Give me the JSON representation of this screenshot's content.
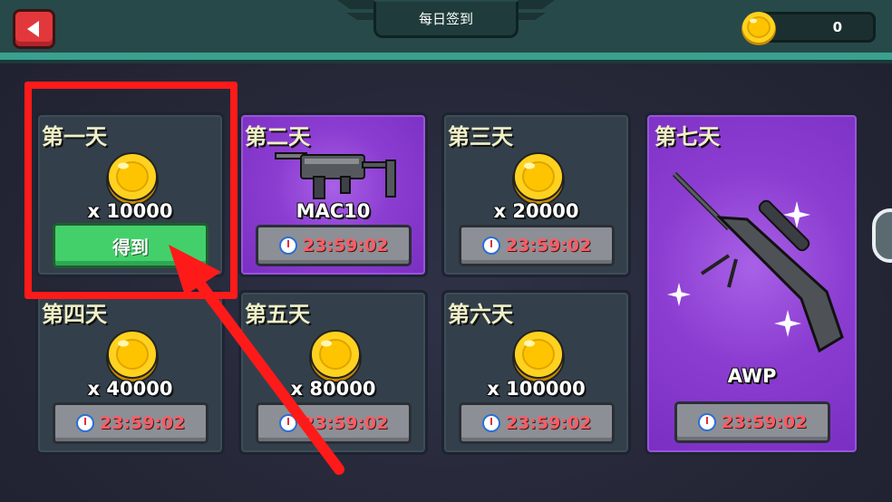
{
  "header": {
    "title": "每日签到",
    "coin_balance": "0"
  },
  "days": [
    {
      "label": "第一天",
      "reward_type": "coin",
      "amount": "x 10000",
      "status": "claimable",
      "button_label": "得到"
    },
    {
      "label": "第二天",
      "reward_type": "weapon",
      "weapon_name": "MAC10",
      "timer": "23:59:02"
    },
    {
      "label": "第三天",
      "reward_type": "coin",
      "amount": "x 20000",
      "timer": "23:59:02"
    },
    {
      "label": "第四天",
      "reward_type": "coin",
      "amount": "x 40000",
      "timer": "23:59:02"
    },
    {
      "label": "第五天",
      "reward_type": "coin",
      "amount": "x 80000",
      "timer": "23:59:02"
    },
    {
      "label": "第六天",
      "reward_type": "coin",
      "amount": "x 100000",
      "timer": "23:59:02"
    },
    {
      "label": "第七天",
      "reward_type": "weapon",
      "weapon_name": "AWP",
      "timer": "23:59:02"
    }
  ],
  "colors": {
    "topbar": "#27494a",
    "accent_teal": "#3aa08f",
    "card": "#33404b",
    "card_purple": "#8c3dd1",
    "claim_green": "#43d06b",
    "timer_red": "#ff5b63",
    "highlight_red": "#ff1a1a"
  }
}
